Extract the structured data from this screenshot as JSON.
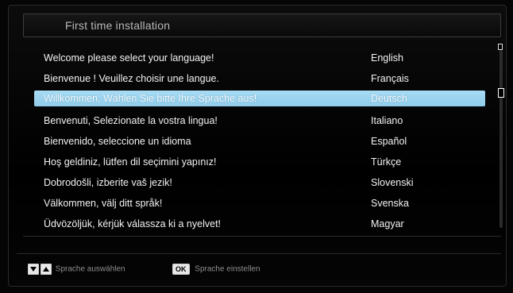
{
  "header": {
    "title": "First time installation"
  },
  "languages": [
    {
      "message": "Welcome please select your language!",
      "language": "English",
      "selected": false
    },
    {
      "message": "Bienvenue ! Veuillez choisir une langue.",
      "language": "Français",
      "selected": false
    },
    {
      "message": "Willkommen, Wählen Sie bitte Ihre Sprache aus!",
      "language": "Deutsch",
      "selected": true
    },
    {
      "message": "Benvenuti, Selezionate la vostra lingua!",
      "language": "Italiano",
      "selected": false
    },
    {
      "message": "Bienvenido, seleccione un idioma",
      "language": "Español",
      "selected": false
    },
    {
      "message": "Hoş geldiniz, lütfen dil seçimini yapınız!",
      "language": "Türkçe",
      "selected": false
    },
    {
      "message": "Dobrodošli, izberite vaš jezik!",
      "language": "Slovenski",
      "selected": false
    },
    {
      "message": "Välkommen, välj ditt språk!",
      "language": "Svenska",
      "selected": false
    },
    {
      "message": "Üdvözöljük, kérjük válassza ki a nyelvet!",
      "language": "Magyar",
      "selected": false
    }
  ],
  "footer": {
    "select_hint": "Sprache auswählen",
    "ok_key": "OK",
    "confirm_hint": "Sprache einstellen"
  },
  "colors": {
    "highlight": "#9fd6f1",
    "background": "#000000",
    "text": "#f2f2f2"
  }
}
